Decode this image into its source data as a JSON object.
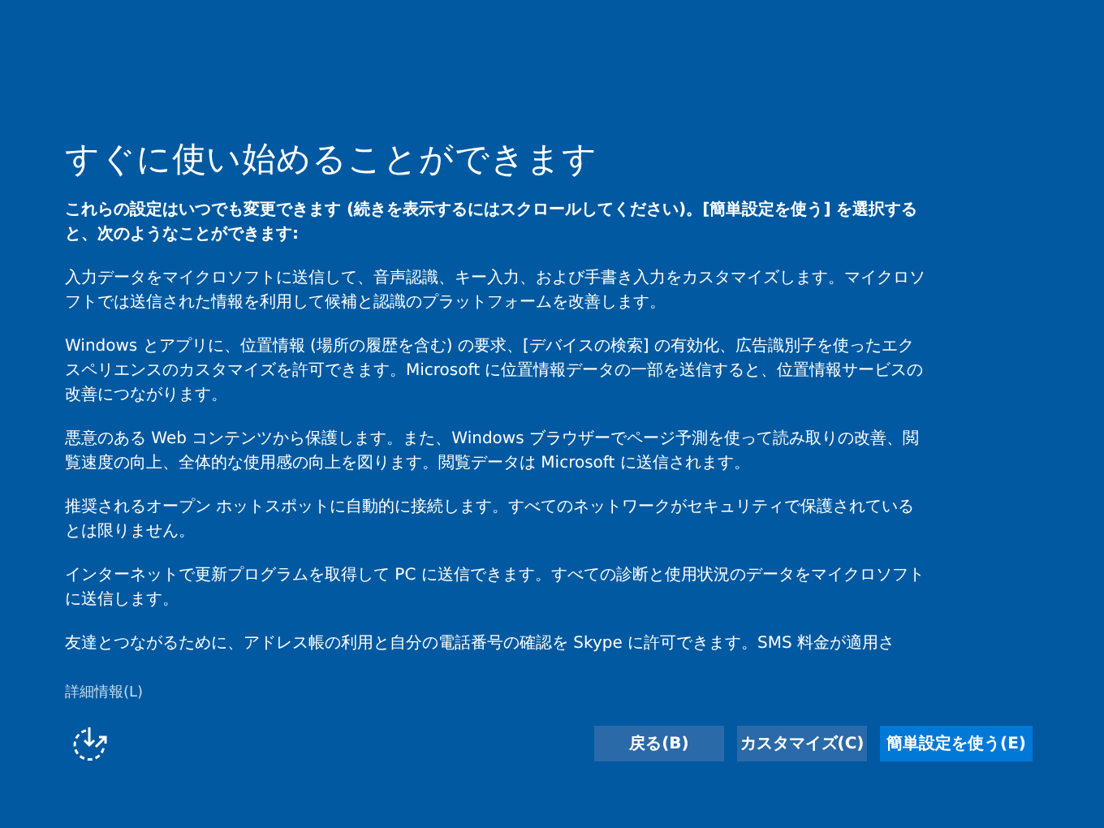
{
  "title": "すぐに使い始めることができます",
  "intro": "これらの設定はいつでも変更できます (続きを表示するにはスクロールしてください)。[簡単設定を使う] を選択すると、次のようなことができます:",
  "paragraphs": [
    "入力データをマイクロソフトに送信して、音声認識、キー入力、および手書き入力をカスタマイズします。マイクロソフトでは送信された情報を利用して候補と認識のプラットフォームを改善します。",
    "Windows とアプリに、位置情報 (場所の履歴を含む) の要求、[デバイスの検索] の有効化、広告識別子を使ったエクスペリエンスのカスタマイズを許可できます。Microsoft に位置情報データの一部を送信すると、位置情報サービスの改善につながります。",
    "悪意のある Web コンテンツから保護します。また、Windows ブラウザーでページ予測を使って読み取りの改善、閲覧速度の向上、全体的な使用感の向上を図ります。閲覧データは Microsoft に送信されます。",
    "推奨されるオープン ホットスポットに自動的に接続します。すべてのネットワークがセキュリティで保護されているとは限りません。",
    "インターネットで更新プログラムを取得して PC に送信できます。すべての診断と使用状況のデータをマイクロソフトに送信します。",
    "友達とつながるために、アドレス帳の利用と自分の電話番号の確認を Skype に許可できます。SMS 料金が適用さ"
  ],
  "details_link": "詳細情報(L)",
  "buttons": [
    {
      "label": "戻る(B)",
      "kind": "secondary"
    },
    {
      "label": "カスタマイズ(C)",
      "kind": "secondary"
    },
    {
      "label": "簡単設定を使う(E)",
      "kind": "primary"
    }
  ]
}
